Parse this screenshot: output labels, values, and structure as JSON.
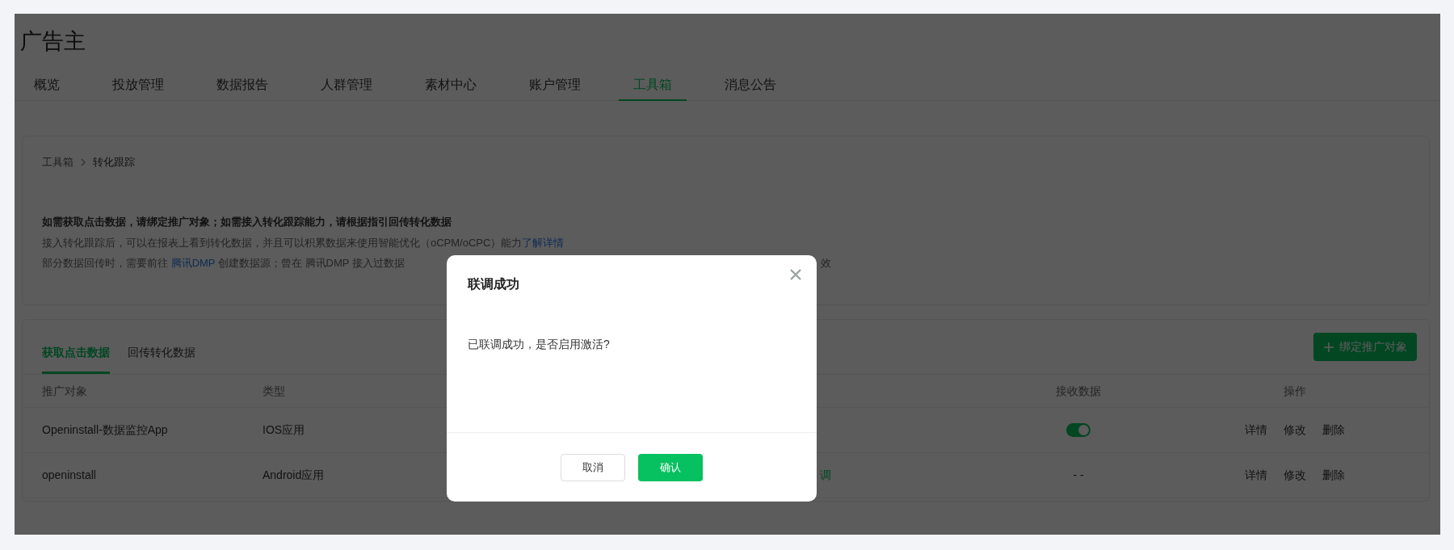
{
  "page_title": "广告主",
  "tabs": [
    {
      "label": "概览",
      "selected": false
    },
    {
      "label": "投放管理",
      "selected": false
    },
    {
      "label": "数据报告",
      "selected": false
    },
    {
      "label": "人群管理",
      "selected": false
    },
    {
      "label": "素材中心",
      "selected": false
    },
    {
      "label": "账户管理",
      "selected": false
    },
    {
      "label": "工具箱",
      "selected": true
    },
    {
      "label": "消息公告",
      "selected": false
    }
  ],
  "breadcrumb": [
    "工具箱",
    "转化跟踪"
  ],
  "notice": {
    "heading": "如需获取点击数据，请绑定推广对象；如需接入转化跟踪能力，请根据指引回传转化数据",
    "line_1": {
      "text": "接入转化跟踪后，可以在报表上看到转化数据，并且可以积累数据来使用智能优化（oCPM/oCPC）能力",
      "link": "了解详情"
    },
    "line_2": {
      "before": "部分数据回传时，需要前往 ",
      "link": "腾讯DMP",
      "after": " 创建数据源；曾在 腾讯DMP 接入过数据",
      "tail": "效"
    }
  },
  "sub_tabs": [
    {
      "label": "获取点击数据",
      "selected": true
    },
    {
      "label": "回传转化数据",
      "selected": false
    }
  ],
  "bind_button": "绑定推广对象",
  "table": {
    "columns": [
      "推广对象",
      "类型",
      "接收数据",
      "操作"
    ],
    "rows": [
      {
        "name": "Openinstall-数据监控App",
        "type": "IOS应用",
        "receive": {
          "kind": "toggle",
          "on": true
        },
        "actions": [
          "详情",
          "修改",
          "删除"
        ]
      },
      {
        "name": "openinstall",
        "type": "Android应用",
        "column_3": "调",
        "receive": {
          "kind": "text",
          "text": "- -"
        },
        "actions": [
          "详情",
          "修改",
          "删除"
        ]
      }
    ]
  },
  "dialog": {
    "title": "联调成功",
    "message": "已联调成功，是否启用激活?",
    "buttons": [
      {
        "label": "取消",
        "kind": "secondary"
      },
      {
        "label": "确认",
        "kind": "primary"
      }
    ]
  }
}
